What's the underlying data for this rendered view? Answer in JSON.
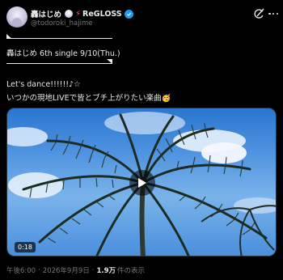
{
  "author": {
    "display_name": "轟はじめ",
    "org_name": "ReGLOSS",
    "handle": "@todoroki_hajime",
    "verified_color": "#1d9bf0"
  },
  "post": {
    "title": "轟はじめ 6th single 9/10(Thu.)",
    "line1": "Let's dance!!!!!!♪☆",
    "line2": "いつかの現地LIVEで皆とブチ上がりたい楽曲🥳"
  },
  "video": {
    "duration": "0:18"
  },
  "meta": {
    "time": "午後6:00",
    "separator": "·",
    "date": "2026年9月9日",
    "views": "1.9万",
    "views_label": "件の表示"
  },
  "icons": {
    "grok": "grok-icon",
    "more": "more-icon",
    "verified": "verified-badge-icon",
    "bolt": "lightning-icon",
    "play": "play-icon"
  }
}
